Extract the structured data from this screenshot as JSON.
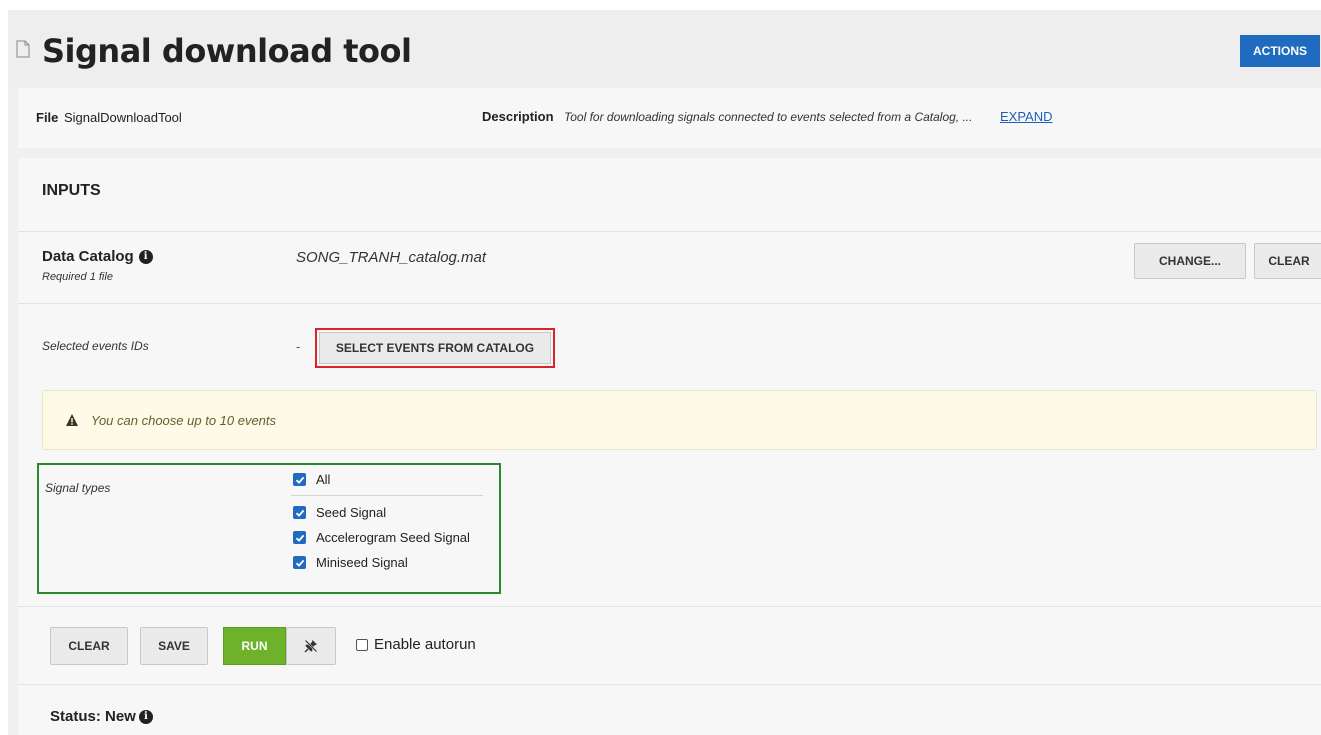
{
  "header": {
    "title": "Signal download tool",
    "actions_label": "ACTIONS"
  },
  "file_info": {
    "file_label": "File",
    "file_value": "SignalDownloadTool",
    "description_label": "Description",
    "description_value": "Tool for downloading signals connected to events selected from a Catalog, ...",
    "expand_label": "EXPAND"
  },
  "inputs": {
    "title": "INPUTS",
    "data_catalog": {
      "label": "Data Catalog",
      "requirement": "Required 1 file",
      "value": "SONG_TRANH_catalog.mat",
      "change_label": "CHANGE...",
      "clear_label": "CLEAR"
    },
    "selected_events": {
      "label": "Selected events IDs",
      "value": "-",
      "button_label": "SELECT EVENTS FROM CATALOG"
    },
    "warning": {
      "text": "You can choose up to 10 events"
    },
    "signal_types": {
      "label": "Signal types",
      "all_label": "All",
      "options": [
        {
          "label": "Seed Signal",
          "checked": true
        },
        {
          "label": "Accelerogram Seed Signal",
          "checked": true
        },
        {
          "label": "Miniseed Signal",
          "checked": true
        }
      ]
    }
  },
  "controls": {
    "clear_label": "CLEAR",
    "save_label": "SAVE",
    "run_label": "RUN",
    "autorun_label": "Enable autorun",
    "autorun_checked": false
  },
  "status": {
    "label": "Status: New"
  },
  "colors": {
    "primary": "#1f6bbf",
    "run": "#6db22a",
    "highlight_red": "#d9252a",
    "highlight_green": "#2c8a2c"
  }
}
